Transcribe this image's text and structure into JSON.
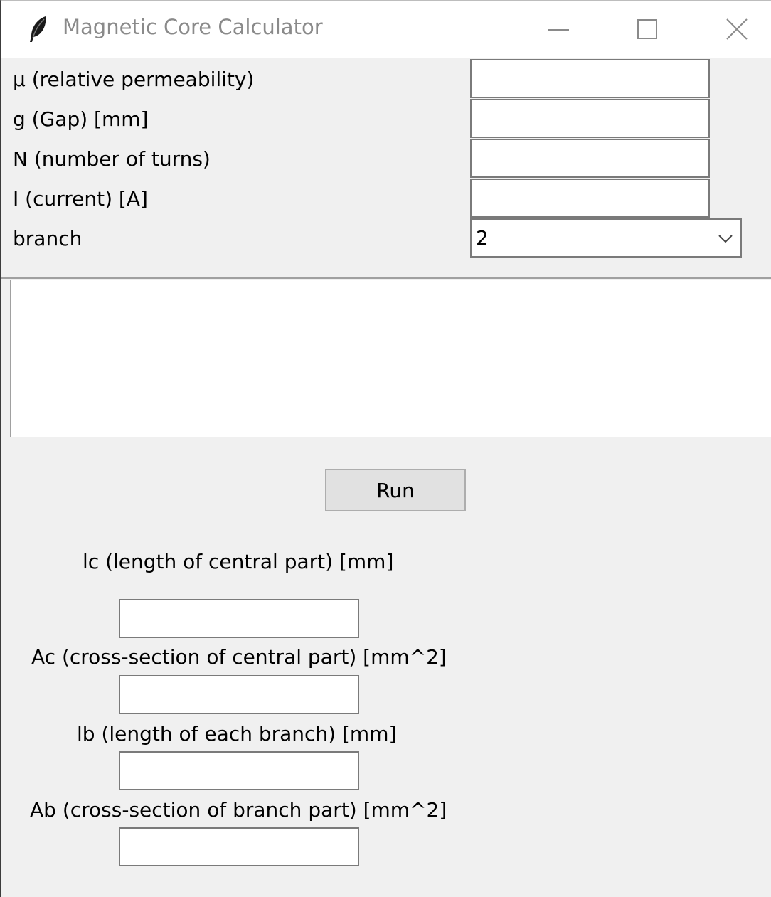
{
  "window": {
    "title": "Magnetic Core Calculator",
    "icon": "feather-icon",
    "controls": [
      "minimize-icon",
      "maximize-icon",
      "close-icon"
    ]
  },
  "inputs": {
    "mu_label": "µ (relative permeability)",
    "mu_value": "",
    "gap_label": "g (Gap) [mm]",
    "gap_value": "",
    "turns_label": "N (number of turns)",
    "turns_value": "",
    "current_label": "I (current) [A]",
    "current_value": "",
    "branch_label": "branch",
    "branch_value": "2"
  },
  "output": {
    "text": ""
  },
  "run": {
    "label": "Run"
  },
  "results": {
    "lc_label": "lc (length of central part) [mm]",
    "lc_value": "",
    "ac_label": "Ac (cross-section of central part) [mm^2]",
    "ac_value": "",
    "lb_label": "lb (length of each branch) [mm]",
    "lb_value": "",
    "ab_label": "Ab (cross-section of branch part) [mm^2]",
    "ab_value": ""
  }
}
